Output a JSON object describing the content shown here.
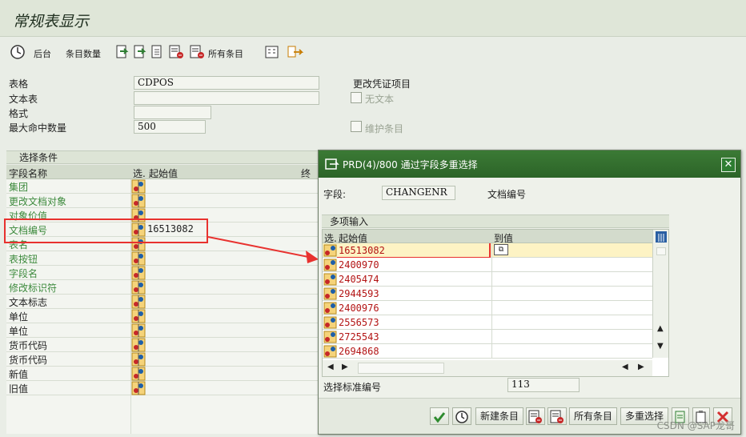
{
  "page": {
    "title": "常规表显示"
  },
  "toolbar": {
    "background_label": "后台",
    "entry_count_label": "条目数量",
    "all_entries_label": "所有条目"
  },
  "form": {
    "table_label": "表格",
    "table_value": "CDPOS",
    "text_table_label": "文本表",
    "text_table_value": "",
    "format_label": "格式",
    "format_value": "",
    "max_hits_label": "最大命中数量",
    "max_hits_value": "500",
    "change_doc_label": "更改凭证项目",
    "no_text_label": "无文本",
    "maintain_entries_label": "维护条目"
  },
  "selection": {
    "section_label": "选择条件",
    "col_field": "字段名称",
    "col_sel": "选.",
    "col_start": "起始值",
    "col_end": "终",
    "rows": [
      {
        "label": "集团",
        "value": ""
      },
      {
        "label": "更改文档对象",
        "value": ""
      },
      {
        "label": "对象价值",
        "value": ""
      },
      {
        "label": "文档编号",
        "value": "16513082"
      },
      {
        "label": "表名",
        "value": ""
      },
      {
        "label": "表按钮",
        "value": ""
      },
      {
        "label": "字段名",
        "value": ""
      },
      {
        "label": "修改标识符",
        "value": ""
      },
      {
        "label": "文本标志",
        "value": ""
      },
      {
        "label": "单位",
        "value": ""
      },
      {
        "label": "单位",
        "value": ""
      },
      {
        "label": "货币代码",
        "value": ""
      },
      {
        "label": "货币代码",
        "value": ""
      },
      {
        "label": "新值",
        "value": ""
      },
      {
        "label": "旧值",
        "value": ""
      }
    ]
  },
  "popup": {
    "title": "PRD(4)/800 通过字段多重选择",
    "field_label": "字段:",
    "field_value": "CHANGENR",
    "field_desc": "文档编号",
    "multi_input_label": "多项输入",
    "col_sel": "选.",
    "col_start": "起始值",
    "col_end": "到值",
    "values": [
      "16513082",
      "2400970",
      "2405474",
      "2944593",
      "2400976",
      "2556573",
      "2725543",
      "2694868"
    ],
    "std_no_label": "选择标准编号",
    "std_no_value": "113",
    "new_entry_label": "新建条目",
    "all_entries_label": "所有条目",
    "multi_select_label": "多重选择"
  },
  "watermark": "CSDN @SAP龙哥",
  "colors": {
    "highlight": "#e8322f",
    "value_red": "#b31414",
    "title_green": "#2e7d32"
  }
}
